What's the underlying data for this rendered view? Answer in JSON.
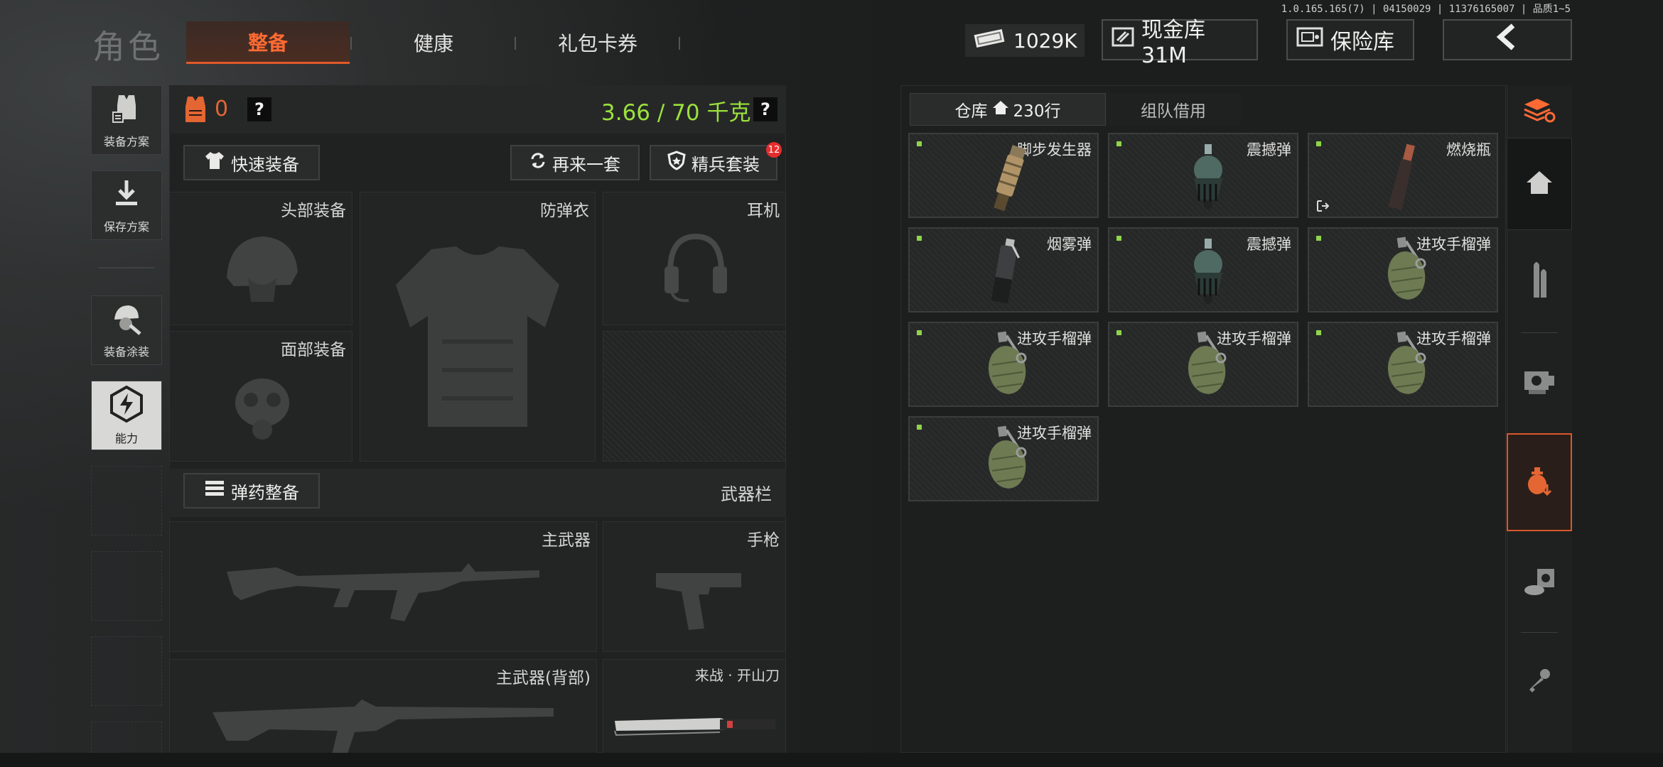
{
  "version": "1.0.165.165(7) | 04150029 | 11376165007 | 品质1~5",
  "nav": {
    "title": "角色",
    "tabs": [
      {
        "label": "整备",
        "active": true
      },
      {
        "label": "健康",
        "active": false
      },
      {
        "label": "礼包卡券",
        "active": false
      }
    ]
  },
  "currency": {
    "money": "1029K",
    "cash_vault": "现金库 31M",
    "safe": "保险库"
  },
  "left_sidebar": [
    {
      "label": "装备方案",
      "icon": "vest-plan-icon"
    },
    {
      "label": "保存方案",
      "icon": "download-icon"
    },
    {
      "label": "装备涂装",
      "icon": "helmet-paint-icon"
    },
    {
      "label": "能力",
      "icon": "lightning-hex-icon",
      "active": true
    }
  ],
  "equipment": {
    "armor_count": "0",
    "weight": "3.66 / 70 千克",
    "quick_equip": "快速装备",
    "again": "再来一套",
    "elite": "精兵套装",
    "elite_badge": "12",
    "slots": {
      "head": "头部装备",
      "vest": "防弹衣",
      "headset": "耳机",
      "face": "面部装备"
    },
    "ammo_prep": "弹药整备",
    "weapon_bar": "武器栏",
    "weapons": {
      "primary": "主武器",
      "pistol": "手枪",
      "primary_back": "主武器(背部)",
      "melee": "来战 · 开山刀"
    }
  },
  "storage": {
    "tab_warehouse": "仓库",
    "warehouse_rows": "230行",
    "tab_team": "组队借用",
    "items": [
      {
        "name": "脚步发生器",
        "icon": "footstep-generator-icon"
      },
      {
        "name": "震撼弹",
        "icon": "stun-grenade-icon"
      },
      {
        "name": "燃烧瓶",
        "icon": "molotov-icon"
      },
      {
        "name": "烟雾弹",
        "icon": "smoke-grenade-icon"
      },
      {
        "name": "震撼弹",
        "icon": "stun-grenade-icon"
      },
      {
        "name": "进攻手榴弹",
        "icon": "frag-grenade-icon"
      },
      {
        "name": "进攻手榴弹",
        "icon": "frag-grenade-icon"
      },
      {
        "name": "进攻手榴弹",
        "icon": "frag-grenade-icon"
      },
      {
        "name": "进攻手榴弹",
        "icon": "frag-grenade-icon"
      },
      {
        "name": "进攻手榴弹",
        "icon": "frag-grenade-icon"
      }
    ]
  },
  "colors": {
    "accent": "#ff6a33",
    "weight_green": "#9be13c",
    "item_dot": "#8fd44a"
  }
}
